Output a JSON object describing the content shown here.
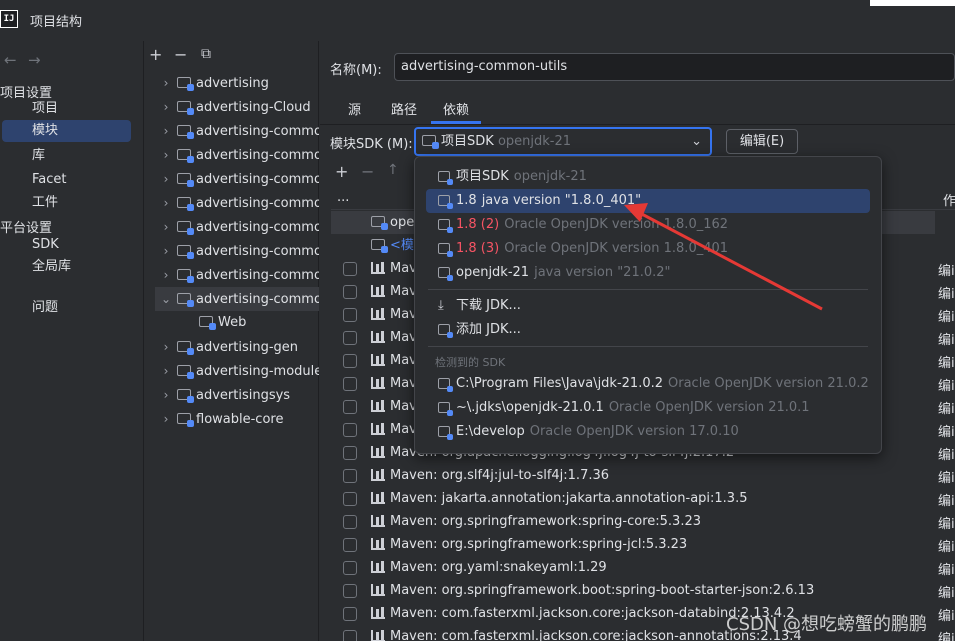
{
  "window": {
    "app_icon": "IJ",
    "title": "项目结构"
  },
  "leftnav": {
    "back_icon": "←",
    "forward_icon": "→",
    "project_settings_header": "项目设置",
    "project_items": [
      "项目",
      "模块",
      "库",
      "Facet",
      "工件"
    ],
    "platform_settings_header": "平台设置",
    "platform_items": [
      "SDK",
      "全局库"
    ],
    "problems": "问题",
    "selected": "模块"
  },
  "tree": {
    "toolbar": {
      "add": "+",
      "remove": "−",
      "copy": "⧉"
    },
    "modules": [
      {
        "name": "advertising",
        "expanded": false
      },
      {
        "name": "advertising-Cloud",
        "expanded": false
      },
      {
        "name": "advertising-common",
        "expanded": false
      },
      {
        "name": "advertising-common",
        "expanded": false
      },
      {
        "name": "advertising-common",
        "expanded": false
      },
      {
        "name": "advertising-common",
        "expanded": false
      },
      {
        "name": "advertising-common",
        "expanded": false
      },
      {
        "name": "advertising-common",
        "expanded": false
      },
      {
        "name": "advertising-common",
        "expanded": false
      },
      {
        "name": "advertising-common",
        "expanded": true
      },
      {
        "name": "Web",
        "child": true
      },
      {
        "name": "advertising-gen",
        "expanded": false
      },
      {
        "name": "advertising-module",
        "expanded": false
      },
      {
        "name": "advertisingsys",
        "expanded": false
      },
      {
        "name": "flowable-core",
        "expanded": false
      }
    ]
  },
  "main": {
    "name_label": "名称(M):",
    "name_value": "advertising-common-utils",
    "tabs": [
      "源",
      "路径",
      "依赖"
    ],
    "active_tab": "依赖",
    "sdk_label": "模块SDK (M):",
    "sdk_value": "项目SDK",
    "sdk_value_hint": "openjdk-21",
    "edit_button": "编辑(E)",
    "dep_toolbar": {
      "add": "+",
      "remove": "−",
      "up": "↑"
    },
    "col_header_more": "...",
    "col_header_scope": "作",
    "dep_rows_top": [
      {
        "text": "ope",
        "indent": true
      },
      {
        "text": "<模",
        "indent": true
      }
    ],
    "dependencies": [
      "Maven: ",
      "Maven: ",
      "Maven: ",
      "Maven: ",
      "Maven: ",
      "Maven: ",
      "Maven: ",
      "Maven: ",
      "Maven: org.apache.logging.log4j:log4j-to-slf4j:2.17.2",
      "Maven: org.slf4j:jul-to-slf4j:1.7.36",
      "Maven: jakarta.annotation:jakarta.annotation-api:1.3.5",
      "Maven: org.springframework:spring-core:5.3.23",
      "Maven: org.springframework:spring-jcl:5.3.23",
      "Maven: org.yaml:snakeyaml:1.29",
      "Maven: org.springframework.boot:spring-boot-starter-json:2.6.13",
      "Maven: com.fasterxml.jackson.core:jackson-databind:2.13.4.2",
      "Maven: com.fasterxml.jackson.core:jackson-annotations:2.13.4"
    ],
    "scope_text": "编i"
  },
  "popup": {
    "items": [
      {
        "name": "项目SDK",
        "detail": "openjdk-21"
      },
      {
        "name": "1.8",
        "detail": "java version \"1.8.0_401\""
      },
      {
        "name": "1.8 (2)",
        "detail": "Oracle OpenJDK version 1.8.0_162"
      },
      {
        "name": "1.8 (3)",
        "detail": "Oracle OpenJDK version 1.8.0_401"
      },
      {
        "name": "openjdk-21",
        "detail": "java version \"21.0.2\""
      }
    ],
    "selected_index": 1,
    "download_jdk": "下载 JDK...",
    "add_jdk": "添加 JDK...",
    "detected_header": "检测到的 SDK",
    "detected": [
      {
        "path": "C:\\Program Files\\Java\\jdk-21.0.2",
        "detail": "Oracle OpenJDK version 21.0.2"
      },
      {
        "path": "~\\.jdks\\openjdk-21.0.1",
        "detail": "Oracle OpenJDK version 21.0.1"
      },
      {
        "path": "E:\\develop",
        "detail": "Oracle OpenJDK version 17.0.10"
      }
    ]
  },
  "colors": {
    "background": "#2b2d30",
    "selection": "#2e436e",
    "accent": "#3574f0",
    "annotation_arrow": "#e53935",
    "error_red": "#f75464"
  },
  "watermark": "CSDN @想吃螃蟹的鹏鹏"
}
